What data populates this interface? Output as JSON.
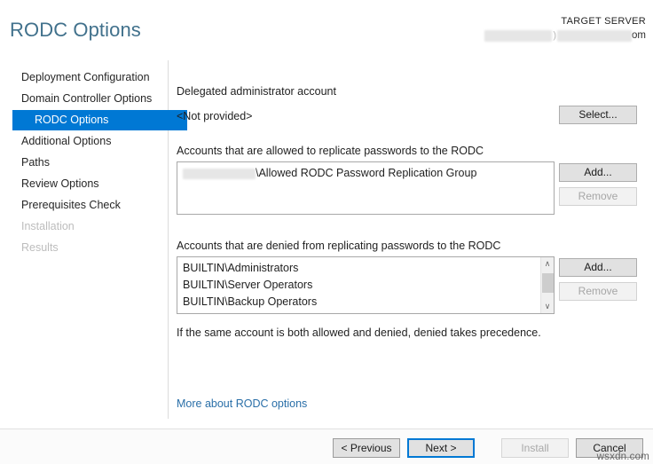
{
  "header": {
    "title": "RODC Options",
    "target_server_label": "TARGET SERVER",
    "target_server_name_suffix": "om",
    "title_color": "#41718c"
  },
  "sidebar": {
    "items": [
      {
        "label": "Deployment Configuration",
        "state": "normal",
        "indent": false
      },
      {
        "label": "Domain Controller Options",
        "state": "normal",
        "indent": false
      },
      {
        "label": "RODC Options",
        "state": "selected",
        "indent": true
      },
      {
        "label": "Additional Options",
        "state": "normal",
        "indent": false
      },
      {
        "label": "Paths",
        "state": "normal",
        "indent": false
      },
      {
        "label": "Review Options",
        "state": "normal",
        "indent": false
      },
      {
        "label": "Prerequisites Check",
        "state": "normal",
        "indent": false
      },
      {
        "label": "Installation",
        "state": "disabled",
        "indent": false
      },
      {
        "label": "Results",
        "state": "disabled",
        "indent": false
      }
    ],
    "selected_color": "#0078d4"
  },
  "main": {
    "delegated_admin": {
      "label": "Delegated administrator account",
      "value": "<Not provided>",
      "select_button": "Select..."
    },
    "allowed": {
      "label": "Accounts that are allowed to replicate passwords to the RODC",
      "items": [
        {
          "redacted_prefix": true,
          "text": "\\Allowed RODC Password Replication Group"
        }
      ],
      "add_button": "Add...",
      "remove_button": "Remove",
      "remove_enabled": false
    },
    "denied": {
      "label": "Accounts that are denied from replicating passwords to the RODC",
      "items": [
        {
          "redacted_prefix": false,
          "text": "BUILTIN\\Administrators"
        },
        {
          "redacted_prefix": false,
          "text": "BUILTIN\\Server Operators"
        },
        {
          "redacted_prefix": false,
          "text": "BUILTIN\\Backup Operators"
        }
      ],
      "add_button": "Add...",
      "remove_button": "Remove",
      "remove_enabled": false,
      "scroll_up_glyph": "∧",
      "scroll_down_glyph": "∨"
    },
    "precedence_note": "If the same account is both allowed and denied, denied takes precedence.",
    "help_link": "More about RODC options"
  },
  "footer": {
    "previous_button": "< Previous",
    "next_button": "Next >",
    "install_button": "Install",
    "cancel_button": "Cancel",
    "next_focused": true,
    "install_enabled": false,
    "watermark": "wsxdn.com"
  }
}
